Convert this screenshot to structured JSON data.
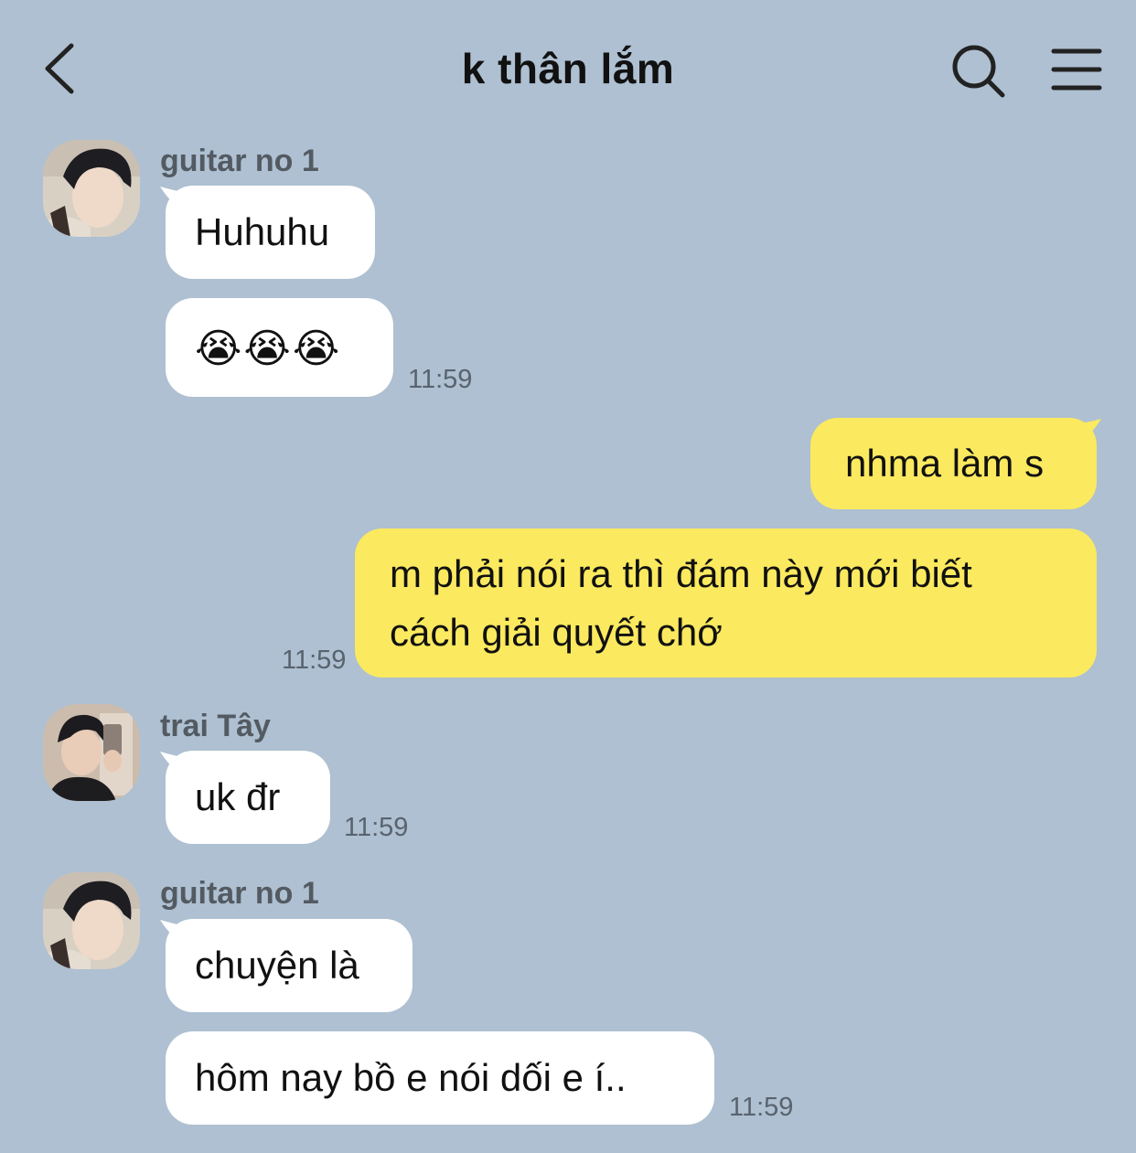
{
  "header": {
    "title": "k thân lắm",
    "back_icon": "chevron-left-icon",
    "search_icon": "search-icon",
    "menu_icon": "hamburger-menu-icon"
  },
  "colors": {
    "background": "#aec0d1",
    "incoming_bubble": "#ffffff",
    "outgoing_bubble": "#fbe95f"
  },
  "messages": [
    {
      "sender": "guitar no 1",
      "text": "Huhuhu",
      "time": ""
    },
    {
      "sender": "guitar no 1",
      "text": "😭😭😭",
      "time": "11:59"
    },
    {
      "sender": "me",
      "text": "nhma làm s",
      "time": ""
    },
    {
      "sender": "me",
      "text_line1": "m phải nói ra thì đám này mới biết",
      "text_line2": "cách giải quyết chớ",
      "time": "11:59"
    },
    {
      "sender": "trai Tây",
      "text": "uk đr",
      "time": "11:59"
    },
    {
      "sender": "guitar no 1",
      "text": "chuyện là",
      "time": ""
    },
    {
      "sender": "guitar no 1",
      "text": "hôm nay bồ e nói dối e í..",
      "time": "11:59"
    }
  ]
}
